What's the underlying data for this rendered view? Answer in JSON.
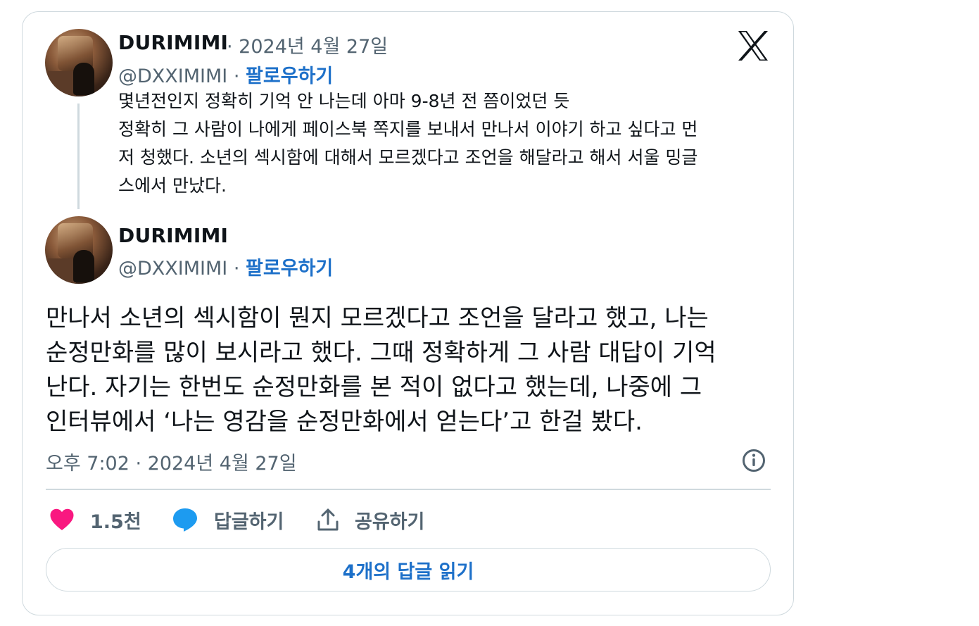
{
  "quoted": {
    "name": "DURIMIMI",
    "date": "· 2024년 4월 27일",
    "handle": "@DXXIMIMI",
    "separator": "·",
    "follow": "팔로우하기",
    "lines": [
      "몇년전인지 정확히 기억 안 나는데 아마 9-8년 전 쯤이었던 듯",
      "정확히 그 사람이 나에게 페이스북 쪽지를 보내서 만나서 이야기 하고 싶다고 먼",
      "저 청했다. 소년의 섹시함에 대해서 모르겠다고 조언을 해달라고 해서 서울 밍글",
      "스에서 만났다."
    ]
  },
  "main": {
    "name": "DURIMIMI",
    "handle": "@DXXIMIMI",
    "separator": "·",
    "follow": "팔로우하기",
    "lines": [
      "만나서 소년의 섹시함이 뭔지 모르겠다고 조언을 달라고 했고, 나는",
      "순정만화를 많이 보시라고 했다. 그때 정확하게 그 사람 대답이 기억",
      "난다. 자기는 한번도 순정만화를 본 적이 없다고 했는데, 나중에 그",
      "인터뷰에서 ‘나는 영감을 순정만화에서 얻는다’고 한걸 봤다."
    ],
    "timestamp": "오후 7:02 · 2024년 4월 27일"
  },
  "actions": {
    "like_count": "1.5천",
    "reply_label": "답글하기",
    "share_label": "공유하기"
  },
  "read_replies": "4개의 답글 읽기",
  "icons": {
    "logo": "x-logo-icon",
    "like": "heart-icon",
    "reply": "speech-bubble-icon",
    "share": "share-upload-icon",
    "info": "info-icon"
  },
  "colors": {
    "heart": "#f91880",
    "reply_bubble": "#1d9bf0",
    "link": "#1d70c9",
    "muted": "#536471",
    "border": "#cfd9de"
  }
}
